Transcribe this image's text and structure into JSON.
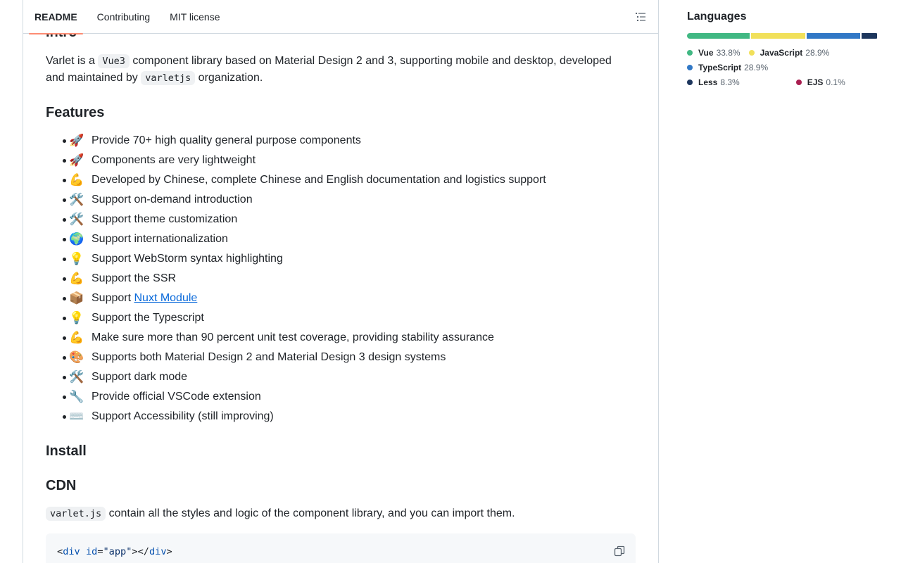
{
  "tabs": [
    {
      "label": "README",
      "active": true
    },
    {
      "label": "Contributing",
      "active": false
    },
    {
      "label": "MIT license",
      "active": false
    }
  ],
  "readme": {
    "clipped_heading": "Intro",
    "intro": {
      "t1": "Varlet is a ",
      "code1": "Vue3",
      "t2": " component library based on Material Design 2 and 3, supporting mobile and desktop, developed",
      "t3": "and maintained by ",
      "code2": "varletjs",
      "t4": " organization."
    },
    "features_heading": "Features",
    "features": [
      {
        "emoji": "🚀",
        "text": "Provide 70+ high quality general purpose components"
      },
      {
        "emoji": "🚀",
        "text": "Components are very lightweight"
      },
      {
        "emoji": "💪",
        "text": "Developed by Chinese, complete Chinese and English documentation and logistics support"
      },
      {
        "emoji": "🛠️",
        "text": "Support on-demand introduction"
      },
      {
        "emoji": "🛠️",
        "text": "Support theme customization"
      },
      {
        "emoji": "🌍",
        "text": "Support internationalization"
      },
      {
        "emoji": "💡",
        "text": "Support WebStorm syntax highlighting"
      },
      {
        "emoji": "💪",
        "text": "Support the SSR"
      },
      {
        "emoji": "📦",
        "text": "Support ",
        "link": "Nuxt Module"
      },
      {
        "emoji": "💡",
        "text": "Support the Typescript"
      },
      {
        "emoji": "💪",
        "text": "Make sure more than 90 percent unit test coverage, providing stability assurance"
      },
      {
        "emoji": "🎨",
        "text": "Supports both Material Design 2 and Material Design 3 design systems"
      },
      {
        "emoji": "🛠️",
        "text": "Support dark mode"
      },
      {
        "emoji": "🔧",
        "text": "Provide official VSCode extension"
      },
      {
        "emoji": "⌨️",
        "text": "Support Accessibility (still improving)"
      }
    ],
    "install_heading": "Install",
    "cdn_heading": "CDN",
    "cdn_para": {
      "code": "varlet.js",
      "text": " contain all the styles and logic of the component library, and you can import them."
    },
    "code_line1": {
      "open": "<",
      "tag1": "div",
      "sp": " ",
      "attr": "id",
      "eq": "=",
      "val": "\"app\"",
      "mid": "></",
      "tag2": "div",
      "close": ">"
    }
  },
  "languages": {
    "title": "Languages",
    "items": [
      {
        "name": "Vue",
        "percent": "33.8%",
        "share": 33.8,
        "color": "#41b883"
      },
      {
        "name": "JavaScript",
        "percent": "28.9%",
        "share": 28.9,
        "color": "#f1e05a"
      },
      {
        "name": "TypeScript",
        "percent": "28.9%",
        "share": 28.9,
        "color": "#3178c6"
      },
      {
        "name": "Less",
        "percent": "8.3%",
        "share": 8.3,
        "color": "#1d365d"
      },
      {
        "name": "EJS",
        "percent": "0.1%",
        "share": 0.1,
        "color": "#a91e50"
      }
    ]
  },
  "icons": {
    "outline": "list-outline-icon",
    "copy": "copy-icon"
  }
}
